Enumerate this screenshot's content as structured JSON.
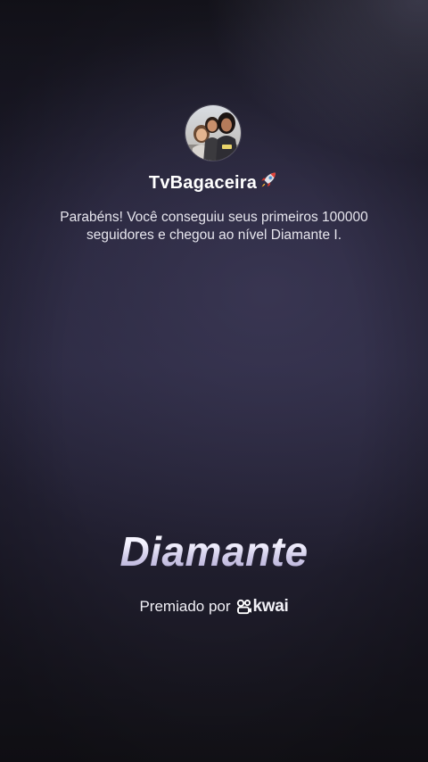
{
  "profile": {
    "username": "TvBagaceira",
    "avatar_icon": "profile-photo-icon",
    "badge_icon": "rocket-icon"
  },
  "message": {
    "text": "Parabéns! Você conseguiu seus primeiros 100000 seguidores e chegou ao nível Diamante I."
  },
  "level": {
    "name": "Diamante"
  },
  "award": {
    "label": "Premiado por",
    "brand_name": "kwai",
    "brand_icon": "kwai-logo-icon"
  },
  "colors": {
    "background_top": "#17161f",
    "background_mid": "#2a2840",
    "background_bottom": "#141319",
    "text": "#ffffff",
    "level_gradient_end": "#9c93c6"
  }
}
